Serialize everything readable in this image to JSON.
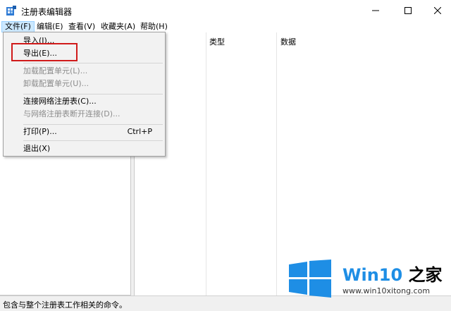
{
  "window": {
    "title": "注册表编辑器",
    "app_icon": "regedit-icon",
    "controls": [
      "minimize-icon",
      "maximize-icon",
      "close-icon"
    ]
  },
  "menubar": {
    "items": [
      {
        "label": "文件(F)",
        "active": true
      },
      {
        "label": "编辑(E)"
      },
      {
        "label": "查看(V)"
      },
      {
        "label": "收藏夹(A)"
      },
      {
        "label": "帮助(H)"
      }
    ]
  },
  "file_menu": {
    "items": [
      {
        "label": "导入(I)...",
        "enabled": true
      },
      {
        "label": "导出(E)...",
        "enabled": true,
        "highlighted": true
      },
      {
        "label": "加载配置单元(L)...",
        "enabled": false
      },
      {
        "label": "卸载配置单元(U)...",
        "enabled": false
      },
      {
        "label": "连接网络注册表(C)...",
        "enabled": true
      },
      {
        "label": "与网络注册表断开连接(D)...",
        "enabled": false
      },
      {
        "label": "打印(P)...",
        "enabled": true,
        "shortcut": "Ctrl+P"
      },
      {
        "label": "退出(X)",
        "enabled": true
      }
    ],
    "highlight_color": "#d01a1a"
  },
  "list_view": {
    "columns": [
      "类型",
      "数据"
    ]
  },
  "statusbar": {
    "text": "包含与整个注册表工作相关的命令。"
  },
  "watermark": {
    "brand_part1": "Win10",
    "brand_part2": " 之家",
    "url": "www.win10xitong.com",
    "logo": "windows-logo-icon",
    "brand_color": "#1e8ee5"
  }
}
